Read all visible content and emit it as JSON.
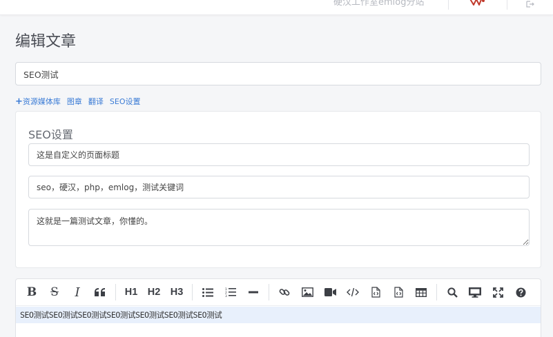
{
  "header": {
    "tagline": "硬汉工作室emlog分站",
    "colors": {
      "bg": "#ffffff",
      "muted": "#b6b9c0"
    }
  },
  "page": {
    "title": "编辑文章"
  },
  "post": {
    "title_value": "SEO测试"
  },
  "links": {
    "media": "资源媒体库",
    "cover": "图章",
    "translate": "翻译",
    "seo": "SEO设置"
  },
  "seo": {
    "heading": "SEO设置",
    "page_title_value": "这是自定义的页面标题",
    "keywords_value": "seo，硬汉，php，emlog，测试关键词",
    "description_value": "这就是一篇测试文章，你懂的。"
  },
  "toolbar": {
    "bold": "B",
    "strike": "S",
    "italic": "I",
    "quote": "❝",
    "h1": "H1",
    "h2": "H2",
    "h3": "H3"
  },
  "editor": {
    "content": "SEO测试SEO测试SEO测试SEO测试SEO测试SEO测试SEO测试"
  },
  "icons": {
    "avatar": "avatar-icon",
    "logout": "logout-icon",
    "bullet_list": "bullet-list-icon",
    "ordered_list": "ordered-list-icon",
    "hr": "horizontal-rule-icon",
    "link": "link-icon",
    "image": "image-icon",
    "video": "video-icon",
    "code": "code-icon",
    "file_code": "file-code-icon",
    "file_code2": "file-code2-icon",
    "table": "table-icon",
    "search": "search-icon",
    "preview": "monitor-icon",
    "fullscreen": "fullscreen-icon",
    "help": "help-icon"
  },
  "colors": {
    "accent": "#3a7bd5",
    "highlight": "#e8f0fc"
  }
}
